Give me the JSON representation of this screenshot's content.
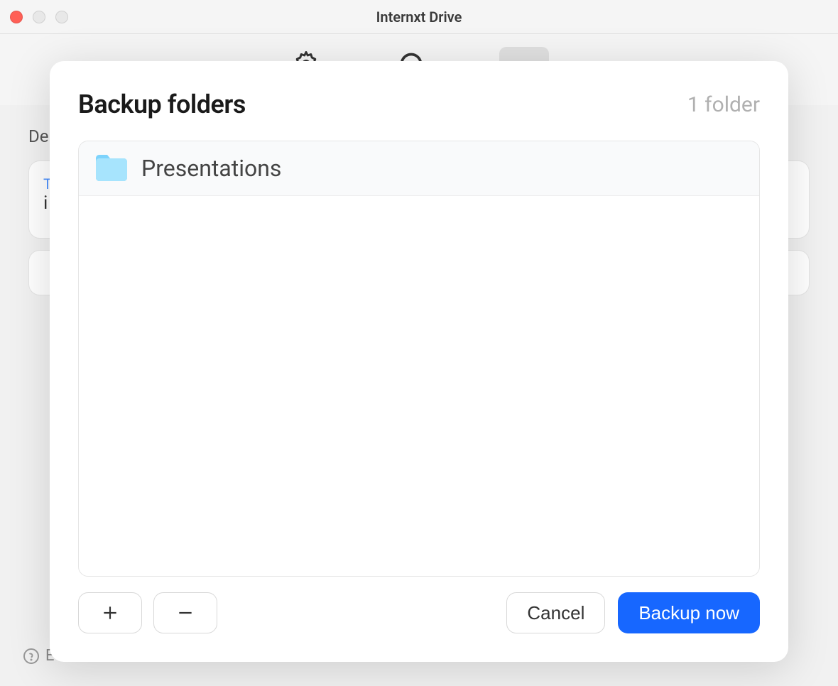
{
  "window": {
    "title": "Internxt Drive"
  },
  "background": {
    "devices_label": "De",
    "this_device_label": "T",
    "device_name_prefix": "i",
    "help_prefix": "E"
  },
  "modal": {
    "title": "Backup folders",
    "count": "1 folder",
    "folders": [
      {
        "name": "Presentations"
      }
    ],
    "buttons": {
      "cancel": "Cancel",
      "backup": "Backup now"
    }
  }
}
